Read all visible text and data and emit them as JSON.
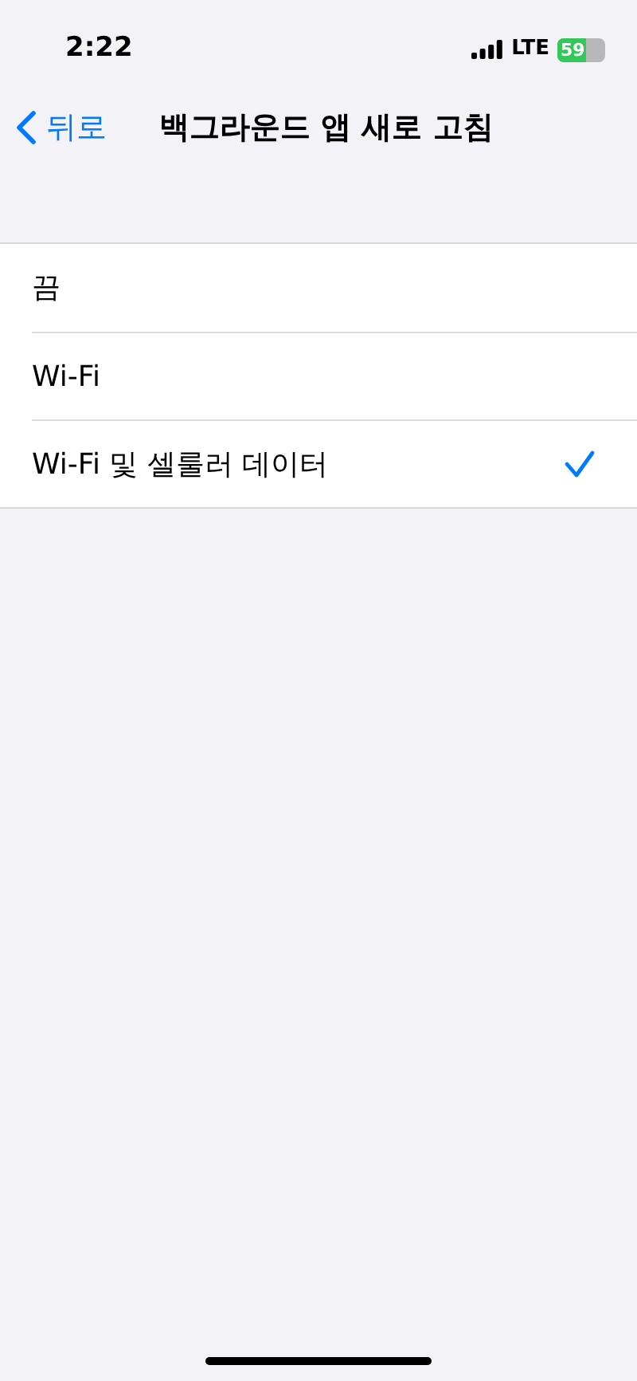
{
  "status_bar": {
    "time": "2:22",
    "network": "LTE",
    "battery": "59"
  },
  "nav": {
    "back": "뒤로",
    "title": "백그라운드 앱 새로 고침"
  },
  "options": [
    {
      "label": "끔",
      "selected": false
    },
    {
      "label": "Wi-Fi",
      "selected": false
    },
    {
      "label": "Wi-Fi 및 셀룰러 데이터",
      "selected": true
    }
  ]
}
